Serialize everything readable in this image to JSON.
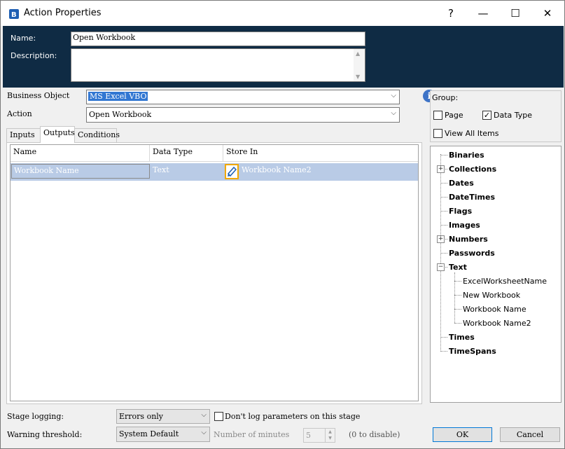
{
  "window": {
    "title": "Action Properties",
    "help_glyph": "?",
    "min_glyph": "—",
    "max_glyph": "☐",
    "close_glyph": "✕"
  },
  "header": {
    "name_label": "Name:",
    "name_value": "Open Workbook",
    "description_label": "Description:",
    "description_value": ""
  },
  "business_object": {
    "label": "Business Object",
    "value": "MS Excel VBO"
  },
  "action": {
    "label": "Action",
    "value": "Open Workbook"
  },
  "tabs": {
    "inputs": "Inputs",
    "outputs": "Outputs",
    "conditions": "Conditions",
    "active": "Outputs"
  },
  "grid": {
    "columns": [
      "Name",
      "Data Type",
      "Store In"
    ],
    "rows": [
      {
        "name": "Workbook Name",
        "data_type": "Text",
        "store_in": "Workbook Name2"
      }
    ]
  },
  "group": {
    "label": "Group:",
    "page_label": "Page",
    "page_checked": false,
    "datatype_label": "Data Type",
    "datatype_checked": true,
    "viewall_label": "View All Items",
    "viewall_checked": false
  },
  "tree": {
    "items": [
      {
        "label": "Binaries",
        "expander": ""
      },
      {
        "label": "Collections",
        "expander": "+"
      },
      {
        "label": "Dates",
        "expander": ""
      },
      {
        "label": "DateTimes",
        "expander": ""
      },
      {
        "label": "Flags",
        "expander": ""
      },
      {
        "label": "Images",
        "expander": ""
      },
      {
        "label": "Numbers",
        "expander": "+"
      },
      {
        "label": "Passwords",
        "expander": ""
      },
      {
        "label": "Text",
        "expander": "−"
      },
      {
        "label": "ExcelWorksheetName",
        "expander": ""
      },
      {
        "label": "New Workbook",
        "expander": ""
      },
      {
        "label": "Workbook Name",
        "expander": ""
      },
      {
        "label": "Workbook Name2",
        "expander": ""
      },
      {
        "label": "Times",
        "expander": ""
      },
      {
        "label": "TimeSpans",
        "expander": ""
      }
    ]
  },
  "bottom": {
    "stage_logging_label": "Stage logging:",
    "stage_logging_value": "Errors only",
    "dont_log_label": "Don't log parameters on this stage",
    "warning_label": "Warning threshold:",
    "warning_value": "System Default",
    "minutes_label": "Number of minutes",
    "minutes_value": "5",
    "disable_hint": "(0 to disable)",
    "ok_label": "OK",
    "cancel_label": "Cancel"
  },
  "colors": {
    "header_band": "#0f2b44",
    "selection_blue": "#3277d2",
    "row_highlight": "#b9cbe6",
    "store_icon_border": "#f0a800"
  }
}
